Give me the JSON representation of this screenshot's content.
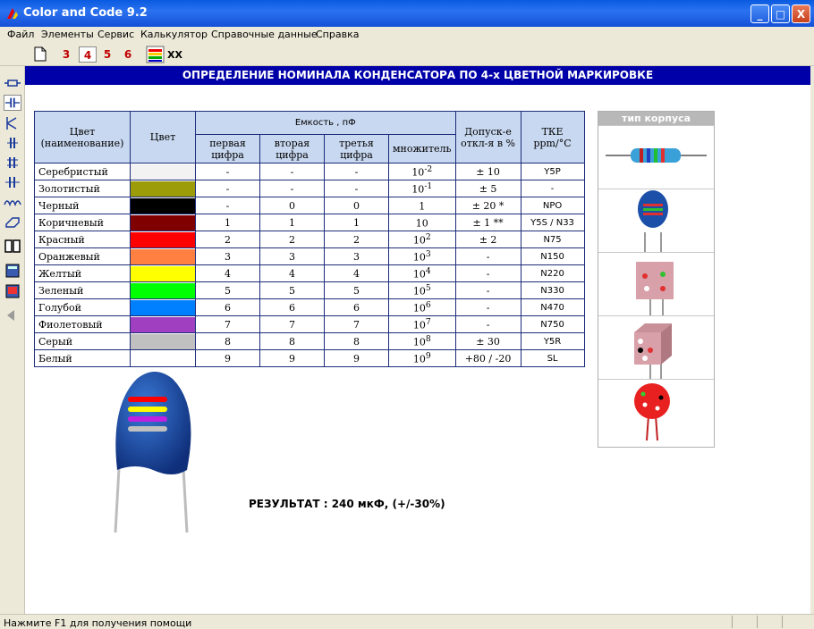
{
  "window": {
    "title": "Color and Code 9.2",
    "min": "_",
    "max": "□",
    "close": "X"
  },
  "menu": [
    "Файл",
    "Элементы",
    "Сервис",
    "Калькулятор",
    "Справочные данные",
    "Справка"
  ],
  "toolbar": {
    "bands": [
      "3",
      "4",
      "5",
      "6"
    ],
    "active_band": "4",
    "xx_label": "XX"
  },
  "header": "ОПРЕДЕЛЕНИЕ НОМИНАЛА КОНДЕНСАТОРА ПО 4-х ЦВЕТНОЙ МАРКИРОВКЕ",
  "table": {
    "h_color_name": "Цвет\n(наименование)",
    "h_color": "Цвет",
    "h_capacity": "Емкость , пФ",
    "h_tol": "Допуск-е\nоткл-я в %",
    "h_tke": "ТКЕ\nppm/°C",
    "h_d1": "первая цифра",
    "h_d2": "вторая цифра",
    "h_d3": "третья цифра",
    "h_mult": "множитель",
    "rows": [
      {
        "name": "Серебристый",
        "color": "#f2f2f2",
        "d1": "-",
        "d2": "-",
        "d3": "-",
        "mult": "10",
        "exp": "-2",
        "tol": "± 10",
        "tke": "Y5P"
      },
      {
        "name": "Золотистый",
        "color": "#9c9c08",
        "d1": "-",
        "d2": "-",
        "d3": "-",
        "mult": "10",
        "exp": "-1",
        "tol": "± 5",
        "tke": "-"
      },
      {
        "name": "Черный",
        "color": "#000000",
        "d1": "-",
        "d2": "0",
        "d3": "0",
        "mult": "1",
        "exp": "",
        "tol": "± 20 *",
        "tke": "NPO"
      },
      {
        "name": "Коричневый",
        "color": "#800000",
        "d1": "1",
        "d2": "1",
        "d3": "1",
        "mult": "10",
        "exp": "",
        "tol": "± 1 **",
        "tke": "Y5S / N33"
      },
      {
        "name": "Красный",
        "color": "#ff0000",
        "d1": "2",
        "d2": "2",
        "d3": "2",
        "mult": "10",
        "exp": "2",
        "tol": "± 2",
        "tke": "N75"
      },
      {
        "name": "Оранжевый",
        "color": "#ff8040",
        "d1": "3",
        "d2": "3",
        "d3": "3",
        "mult": "10",
        "exp": "3",
        "tol": "-",
        "tke": "N150"
      },
      {
        "name": "Желтый",
        "color": "#ffff00",
        "d1": "4",
        "d2": "4",
        "d3": "4",
        "mult": "10",
        "exp": "4",
        "tol": "-",
        "tke": "N220"
      },
      {
        "name": "Зеленый",
        "color": "#00ff00",
        "d1": "5",
        "d2": "5",
        "d3": "5",
        "mult": "10",
        "exp": "5",
        "tol": "-",
        "tke": "N330"
      },
      {
        "name": "Голубой",
        "color": "#0080ff",
        "d1": "6",
        "d2": "6",
        "d3": "6",
        "mult": "10",
        "exp": "6",
        "tol": "-",
        "tke": "N470"
      },
      {
        "name": "Фиолетовый",
        "color": "#a040c0",
        "d1": "7",
        "d2": "7",
        "d3": "7",
        "mult": "10",
        "exp": "7",
        "tol": "-",
        "tke": "N750"
      },
      {
        "name": "Серый",
        "color": "#c0c0c0",
        "d1": "8",
        "d2": "8",
        "d3": "8",
        "mult": "10",
        "exp": "8",
        "tol": "± 30",
        "tke": "Y5R"
      },
      {
        "name": "Белый",
        "color": "#ffffff",
        "d1": "9",
        "d2": "9",
        "d3": "9",
        "mult": "10",
        "exp": "9",
        "tol": "+80 / -20",
        "tke": "SL"
      }
    ]
  },
  "case_panel": {
    "title": "тип корпуса"
  },
  "result": "РЕЗУЛЬТАТ : 240 мкФ, (+/-30%)",
  "capacitor_bands": [
    "#ff0000",
    "#ffff00",
    "#c020e0",
    "#c0c0c0"
  ],
  "status": "Нажмите F1 для получения помощи"
}
